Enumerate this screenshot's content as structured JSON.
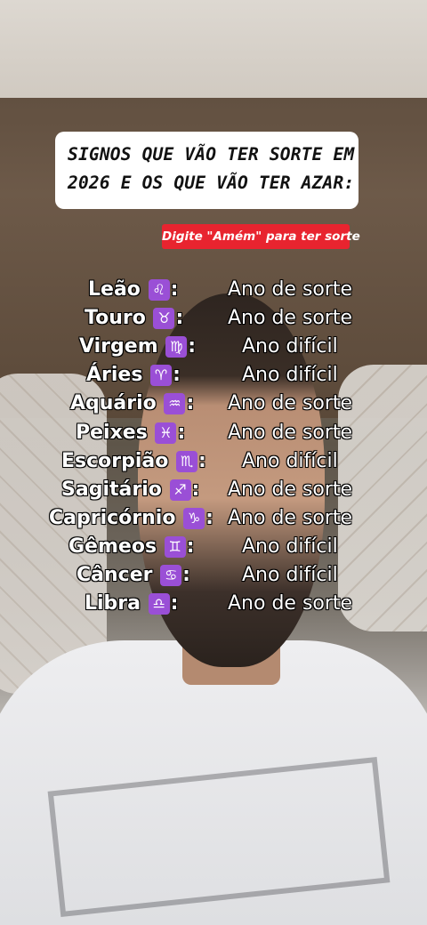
{
  "title": {
    "line1": "SIGNOS QUE VÃO TER SORTE EM",
    "line2": "2026 E OS QUE VÃO TER AZAR:"
  },
  "cta": "Digite \"Amém\" para ter sorte",
  "signs": [
    {
      "name": "Leão",
      "symbol": "♌",
      "icon": "leo-icon",
      "result": "Ano de sorte"
    },
    {
      "name": "Touro",
      "symbol": "♉",
      "icon": "taurus-icon",
      "result": "Ano de sorte"
    },
    {
      "name": "Virgem",
      "symbol": "♍",
      "icon": "virgo-icon",
      "result": "Ano difícil"
    },
    {
      "name": "Áries",
      "symbol": "♈",
      "icon": "aries-icon",
      "result": "Ano difícil"
    },
    {
      "name": "Aquário",
      "symbol": "♒",
      "icon": "aquarius-icon",
      "result": "Ano de sorte"
    },
    {
      "name": "Peixes",
      "symbol": "♓",
      "icon": "pisces-icon",
      "result": "Ano de sorte"
    },
    {
      "name": "Escorpião",
      "symbol": "♏",
      "icon": "scorpio-icon",
      "result": "Ano difícil"
    },
    {
      "name": "Sagitário",
      "symbol": "♐",
      "icon": "sagittarius-icon",
      "result": "Ano de sorte"
    },
    {
      "name": "Capricórnio",
      "symbol": "♑",
      "icon": "capricorn-icon",
      "result": "Ano de sorte"
    },
    {
      "name": "Gêmeos",
      "symbol": "♊",
      "icon": "gemini-icon",
      "result": "Ano difícil"
    },
    {
      "name": "Câncer",
      "symbol": "♋",
      "icon": "cancer-icon",
      "result": "Ano difícil"
    },
    {
      "name": "Libra",
      "symbol": "♎",
      "icon": "libra-icon",
      "result": "Ano de sorte"
    }
  ],
  "colors": {
    "cta_background": "#e8242f",
    "zodiac_icon_background": "#9a4fd6",
    "card_background": "#ffffff"
  }
}
